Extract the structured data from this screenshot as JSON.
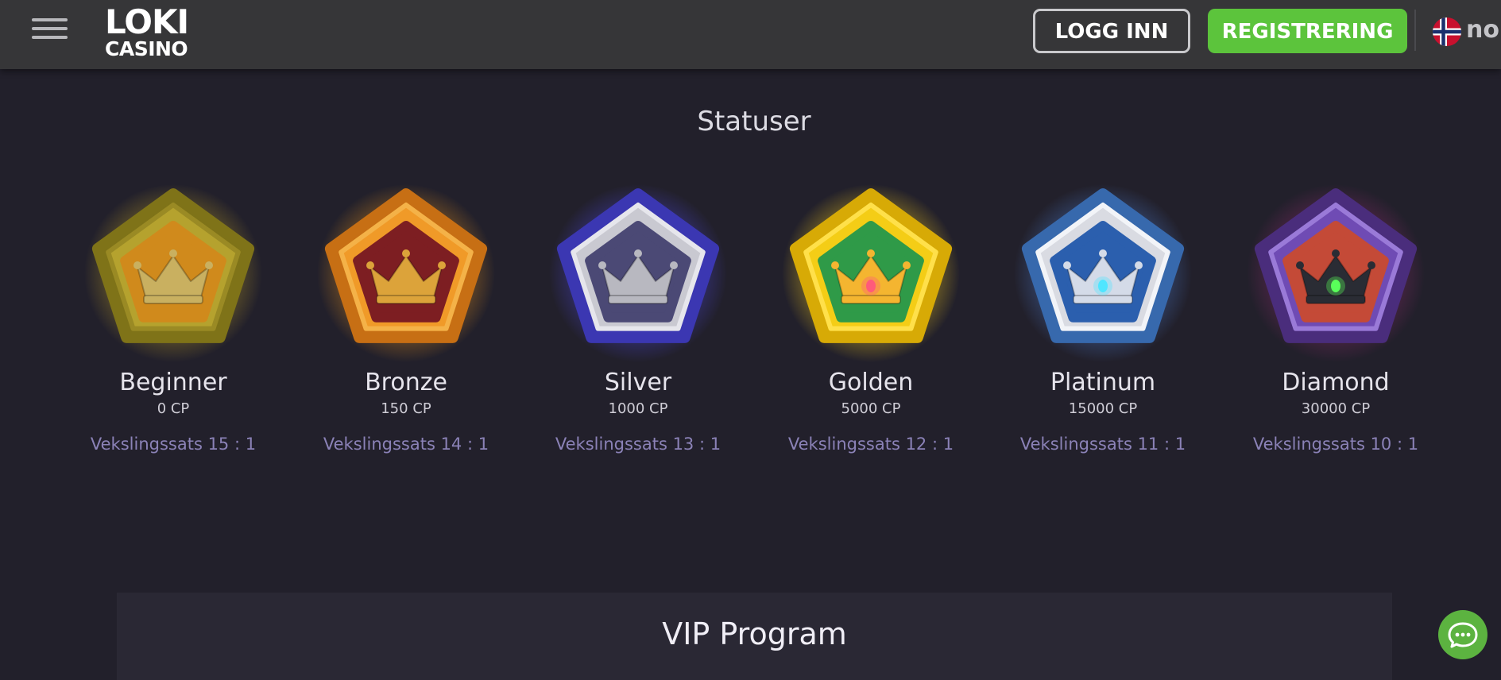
{
  "header": {
    "logo_line1": "LOKI",
    "logo_line2": "CASINO",
    "login_label": "LOGG INN",
    "register_label": "REGISTRERING",
    "language": "no",
    "menu_icon": "hamburger-menu-icon",
    "flag_icon": "norway-flag-icon"
  },
  "statuses": {
    "title": "Statuser",
    "levels": [
      {
        "name": "Beginner",
        "points": "0 CP",
        "rate": "Vekslingssats 15 : 1",
        "theme": "wood"
      },
      {
        "name": "Bronze",
        "points": "150 CP",
        "rate": "Vekslingssats 14 : 1",
        "theme": "bronze"
      },
      {
        "name": "Silver",
        "points": "1000 CP",
        "rate": "Vekslingssats 13 : 1",
        "theme": "silver"
      },
      {
        "name": "Golden",
        "points": "5000 CP",
        "rate": "Vekslingssats 12 : 1",
        "theme": "golden"
      },
      {
        "name": "Platinum",
        "points": "15000 CP",
        "rate": "Vekslingssats 11 : 1",
        "theme": "platinum"
      },
      {
        "name": "Diamond",
        "points": "30000 CP",
        "rate": "Vekslingssats 10 : 1",
        "theme": "diamond"
      }
    ]
  },
  "vip": {
    "title": "VIP Program"
  },
  "chat": {
    "icon": "chat-bubble-icon"
  },
  "colors": {
    "background": "#22202b",
    "header": "#363638",
    "register_green": "#5cc43c",
    "rate_text": "#8b82b7",
    "chat_green": "#5cb340"
  }
}
